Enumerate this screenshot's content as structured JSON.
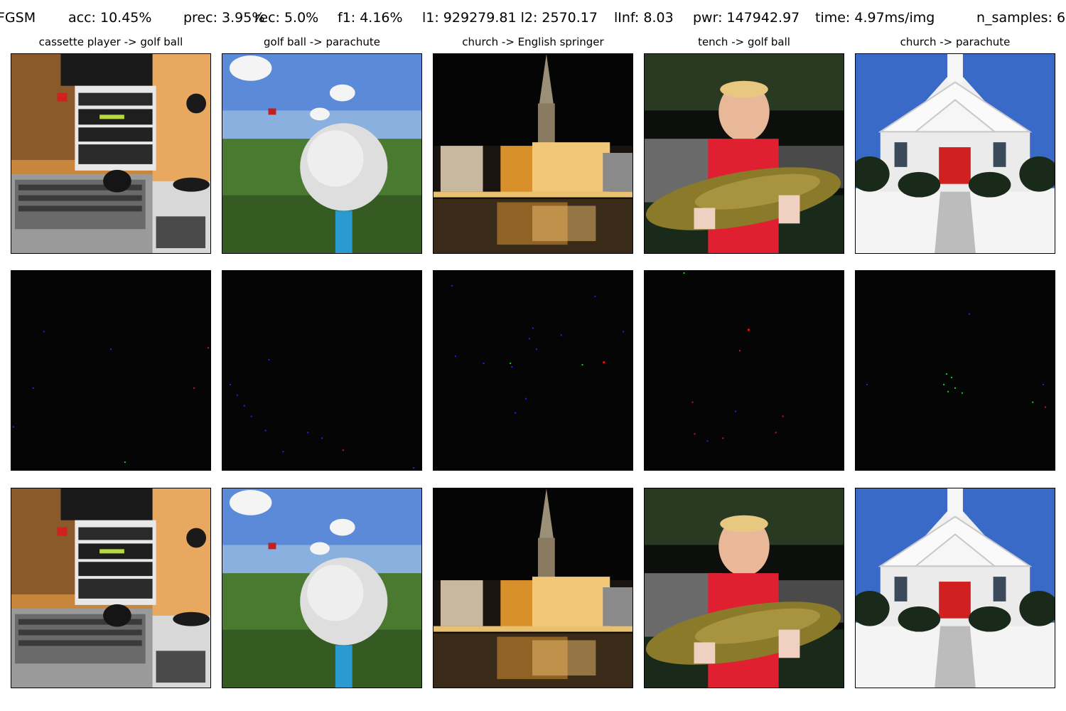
{
  "header": {
    "method": "FGSM",
    "acc": "acc: 10.45%",
    "prec": "prec: 3.95%",
    "rec": "rec: 5.0%",
    "f1": "f1: 4.16%",
    "l1l2": "l1: 929279.81 l2: 2570.17",
    "linf": "lInf: 8.03",
    "pwr": "pwr: 147942.97",
    "time": "time: 4.97ms/img",
    "n_samples": "n_samples: 6"
  },
  "columns": [
    {
      "label": "cassette player -> golf ball"
    },
    {
      "label": "golf ball -> parachute"
    },
    {
      "label": "church -> English springer"
    },
    {
      "label": "tench -> golf ball"
    },
    {
      "label": "church -> parachute"
    }
  ],
  "colors": {
    "background": "#ffffff",
    "perturbation_background": "#050505",
    "perturbation_red": "#e01010",
    "perturbation_green": "#10d020",
    "perturbation_blue": "#2020ff"
  }
}
